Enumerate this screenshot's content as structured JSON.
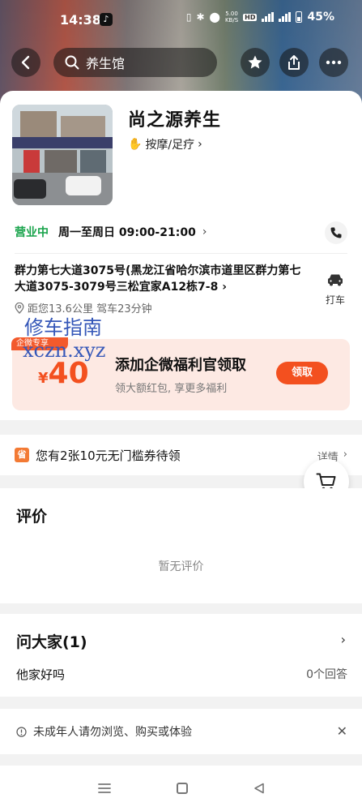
{
  "status_bar": {
    "time": "14:38",
    "network_speed": "5.00",
    "network_unit": "KB/S",
    "hd": "HD",
    "signal_1": "4G",
    "signal_2": "4G",
    "battery": "45%"
  },
  "nav": {
    "search_text": "养生馆"
  },
  "shop": {
    "name": "尚之源养生",
    "category": "按摩/足疗",
    "open_status": "营业中",
    "hours": "周一至周日 09:00-21:00",
    "address": "群力第七大道3075号(黑龙江省哈尔滨市道里区群力第七大道3075-3079号三松宜家A12栋7-8",
    "distance": "距您13.6公里 驾车23分钟",
    "taxi_label": "打车"
  },
  "watermark": {
    "line1": "修车指南",
    "line2": "xczn.xyz"
  },
  "coupon": {
    "tag": "企微专享",
    "currency": "¥",
    "amount": "40",
    "title": "添加企微福利官领取",
    "subtitle": "领大额红包, 享更多福利",
    "claim_label": "领取"
  },
  "voucher": {
    "icon_text": "省",
    "text": "您有2张10元无门槛券待领",
    "detail_label": "详情"
  },
  "reviews": {
    "title": "评价",
    "empty_text": "暂无评价"
  },
  "qa": {
    "title": "问大家(1)",
    "question": "他家好吗",
    "answer_count": "0个回答"
  },
  "notice": {
    "text": "未成年人请勿浏览、购买或体验"
  },
  "colors": {
    "accent": "#f3501f",
    "open_green": "#17a34a",
    "coupon_bg": "#fde9e3"
  }
}
